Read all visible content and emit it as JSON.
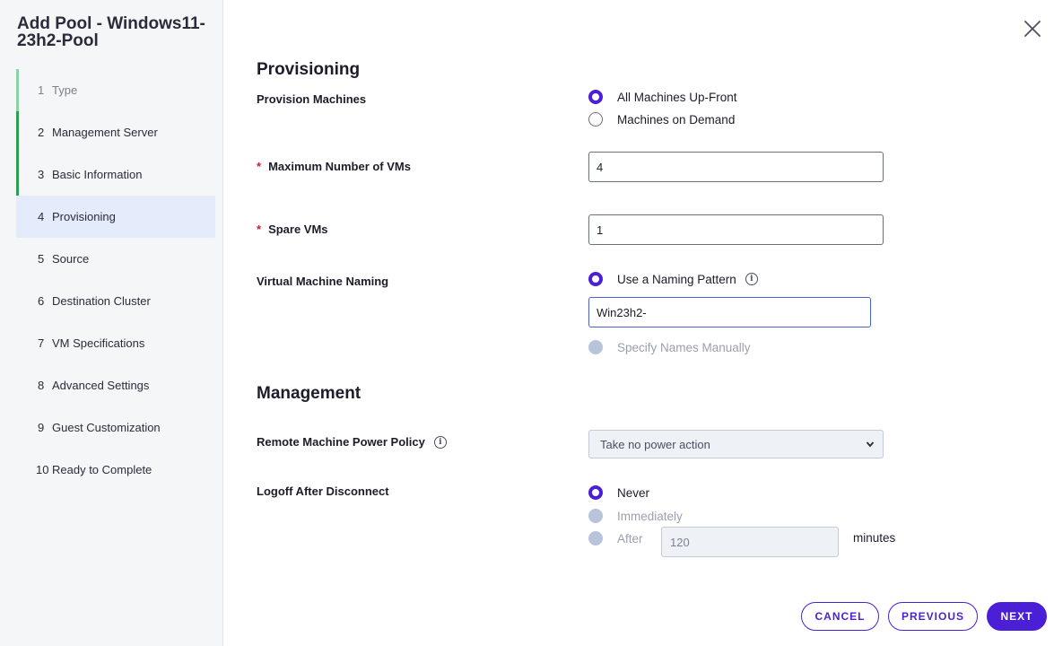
{
  "dialog": {
    "title": "Add Pool - Windows11-23h2-Pool"
  },
  "steps": [
    {
      "num": "1",
      "label": "Type"
    },
    {
      "num": "2",
      "label": "Management Server"
    },
    {
      "num": "3",
      "label": "Basic Information"
    },
    {
      "num": "4",
      "label": "Provisioning"
    },
    {
      "num": "5",
      "label": "Source"
    },
    {
      "num": "6",
      "label": "Destination Cluster"
    },
    {
      "num": "7",
      "label": "VM Specifications"
    },
    {
      "num": "8",
      "label": "Advanced Settings"
    },
    {
      "num": "9",
      "label": "Guest Customization"
    },
    {
      "num": "10",
      "label": "Ready to Complete"
    }
  ],
  "provisioning": {
    "title": "Provisioning",
    "provision_machines": {
      "label": "Provision Machines",
      "options": [
        "All Machines Up-Front",
        "Machines on Demand"
      ],
      "selected": "All Machines Up-Front"
    },
    "max_vms": {
      "label": "Maximum Number of VMs",
      "required_mark": "*",
      "value": "4"
    },
    "spare_vms": {
      "label": "Spare VMs",
      "required_mark": "*",
      "value": "1"
    },
    "vm_naming": {
      "label": "Virtual Machine Naming",
      "option_pattern": "Use a Naming Pattern",
      "pattern_value": "Win23h2-",
      "option_manual": "Specify Names Manually"
    }
  },
  "management": {
    "title": "Management",
    "power_policy": {
      "label": "Remote Machine Power Policy",
      "selected": "Take no power action"
    },
    "logoff": {
      "label": "Logoff After Disconnect",
      "options": [
        "Never",
        "Immediately",
        "After"
      ],
      "selected": "Never",
      "after_value": "120",
      "unit": "minutes"
    }
  },
  "buttons": {
    "cancel": "CANCEL",
    "previous": "PREVIOUS",
    "next": "NEXT"
  },
  "colors": {
    "accent": "#4b1fd6",
    "step_done": "#2e9d4f",
    "active_step_bg": "#e4ebfb",
    "required": "#d2173a"
  }
}
